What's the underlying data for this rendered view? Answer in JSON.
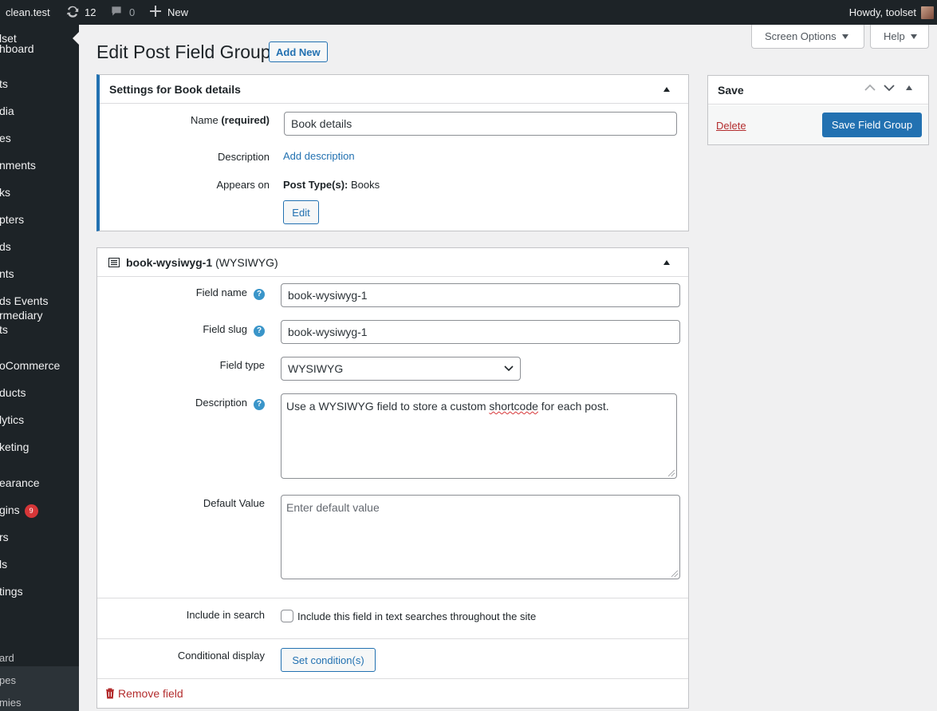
{
  "adminbar": {
    "site": "clean.test",
    "updates_count": "12",
    "comments_count": "0",
    "new_label": "New",
    "howdy": "Howdy, toolset"
  },
  "menu": {
    "items": [
      "hboard",
      "ts",
      "dia",
      "es",
      "nments",
      "ks",
      "pters",
      "ds",
      "nts",
      "ds Events",
      "rmediary",
      "ts",
      "oCommerce",
      "ducts",
      "lytics",
      "keting",
      "earance",
      "gins",
      "rs",
      "ls",
      "tings",
      "lset"
    ],
    "plugins_badge": "9",
    "sub_items": [
      "ard",
      "pes",
      "mies"
    ]
  },
  "screen_options": "Screen Options",
  "help": "Help",
  "page_title": "Edit Post Field Group",
  "add_new": "Add New",
  "settings_box": {
    "title": "Settings for Book details",
    "name_label": "Name",
    "name_required": "(required)",
    "name_value": "Book details",
    "description_label": "Description",
    "add_description": "Add description",
    "appears_on_label": "Appears on",
    "post_types_label": "Post Type(s):",
    "post_types_value": "Books",
    "edit_button": "Edit"
  },
  "field_box": {
    "title": "book-wysiwyg-1",
    "title_type": "(WYSIWYG)",
    "field_name_label": "Field name",
    "field_name_value": "book-wysiwyg-1",
    "field_slug_label": "Field slug",
    "field_slug_value": "book-wysiwyg-1",
    "field_type_label": "Field type",
    "field_type_value": "WYSIWYG",
    "description_label": "Description",
    "description_pre": "Use a WYSIWYG field to store a custom ",
    "description_spell": "shortcode",
    "description_post": " for each post.",
    "default_value_label": "Default Value",
    "default_value_placeholder": "Enter default value",
    "include_search_label": "Include in search",
    "include_search_text": "Include this field in text searches throughout the site",
    "include_search_checked": false,
    "conditional_label": "Conditional display",
    "set_condition_button": "Set condition(s)",
    "remove_field": "Remove field"
  },
  "save_box": {
    "title": "Save",
    "delete": "Delete",
    "save_button": "Save Field Group"
  }
}
